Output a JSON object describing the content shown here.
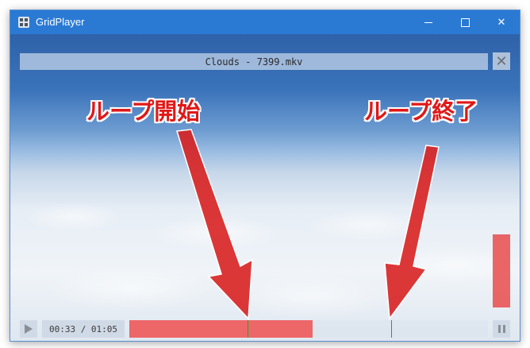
{
  "window": {
    "title": "GridPlayer",
    "icons": {
      "app": "grid-app-icon",
      "minimize": "minimize-icon",
      "maximize": "maximize-icon",
      "close": "close-icon"
    }
  },
  "video": {
    "filename": "Clouds - 7399.mkv",
    "close_label": "✕",
    "annotations": {
      "loop_start": "ループ開始",
      "loop_end": "ループ終了",
      "arrow_color": "#d81c1c"
    }
  },
  "controls": {
    "time": "00:33 / 01:05",
    "progress": 0.51,
    "loop_start": 0.33,
    "loop_end": 0.73,
    "accent": "#f05050",
    "loop_marker_color": "#1ea81e",
    "volume": 1.0
  }
}
